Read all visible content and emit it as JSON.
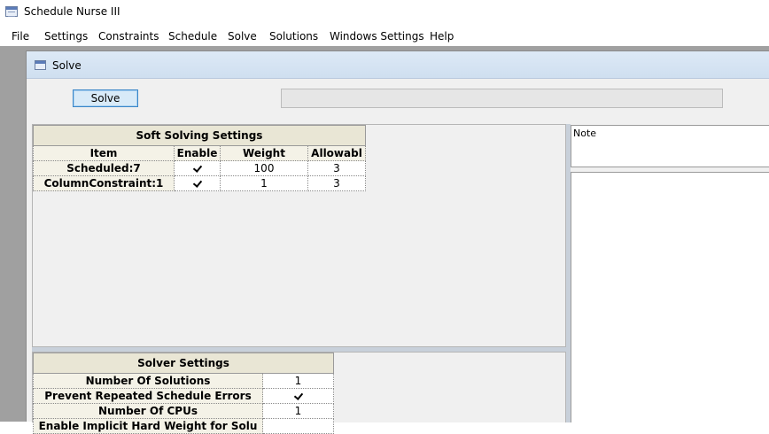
{
  "app": {
    "title": "Schedule Nurse III"
  },
  "menu": [
    "File",
    "Settings",
    "Constraints",
    "Schedule",
    "Solve",
    "Solutions",
    "Windows Settings",
    "Help"
  ],
  "child_window": {
    "title": "Solve"
  },
  "solve_button": "Solve",
  "progress": {
    "value": 0
  },
  "soft_settings": {
    "title": "Soft Solving Settings",
    "columns": [
      "Item",
      "Enable",
      "Weight",
      "Allowabl"
    ],
    "rows": [
      {
        "item": "Scheduled:7",
        "enable": true,
        "weight": "100",
        "allowable": "3"
      },
      {
        "item": "ColumnConstraint:1",
        "enable": true,
        "weight": "1",
        "allowable": "3"
      }
    ]
  },
  "solver_settings": {
    "title": "Solver Settings",
    "rows": [
      {
        "label": "Number Of Solutions",
        "value": "1"
      },
      {
        "label": "Prevent Repeated Schedule Errors",
        "value": "check"
      },
      {
        "label": "Number Of CPUs",
        "value": "1"
      },
      {
        "label": "Enable Implicit Hard Weight for Solu",
        "value": ""
      }
    ]
  },
  "note": {
    "label": "Note"
  },
  "colors": {
    "grid_header": "#e9e6d5",
    "button_accent": "#3a86c8",
    "mdi_background": "#a0a0a0"
  },
  "icons": [
    "app-window-icon",
    "child-window-icon",
    "checkbox-checked-icon"
  ]
}
